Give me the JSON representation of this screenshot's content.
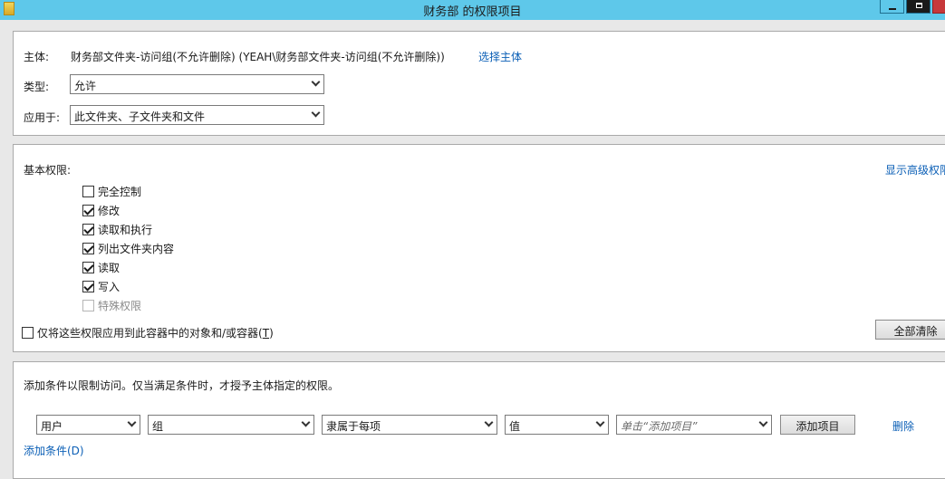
{
  "window": {
    "title": "财务部 的权限项目"
  },
  "principal": {
    "label": "主体:",
    "value": "财务部文件夹-访问组(不允许删除) (YEAH\\财务部文件夹-访问组(不允许删除))",
    "select_link": "选择主体"
  },
  "type": {
    "label": "类型:",
    "selected": "允许"
  },
  "applies_to": {
    "label": "应用于:",
    "selected": "此文件夹、子文件夹和文件"
  },
  "basic_permissions": {
    "label": "基本权限:",
    "advanced_link": "显示高级权限",
    "items": [
      {
        "label": "完全控制",
        "checked": false,
        "disabled": false
      },
      {
        "label": "修改",
        "checked": true,
        "disabled": false
      },
      {
        "label": "读取和执行",
        "checked": true,
        "disabled": false
      },
      {
        "label": "列出文件夹内容",
        "checked": true,
        "disabled": false
      },
      {
        "label": "读取",
        "checked": true,
        "disabled": false
      },
      {
        "label": "写入",
        "checked": true,
        "disabled": false
      },
      {
        "label": "特殊权限",
        "checked": false,
        "disabled": true
      }
    ],
    "apply_only_label": "仅将这些权限应用到此容器中的对象和/或容器(",
    "apply_only_key": "T",
    "apply_only_suffix": ")",
    "clear_all": "全部清除"
  },
  "conditions": {
    "description": "添加条件以限制访问。仅当满足条件时，才授予主体指定的权限。",
    "row": {
      "attribute_class": "用户",
      "attribute": "组",
      "operator": "隶属于每项",
      "value_type": "值",
      "value_placeholder": "单击“添加项目”",
      "add_items_button": "添加项目",
      "remove_link": "删除"
    },
    "add_condition_link": "添加条件(D)"
  }
}
